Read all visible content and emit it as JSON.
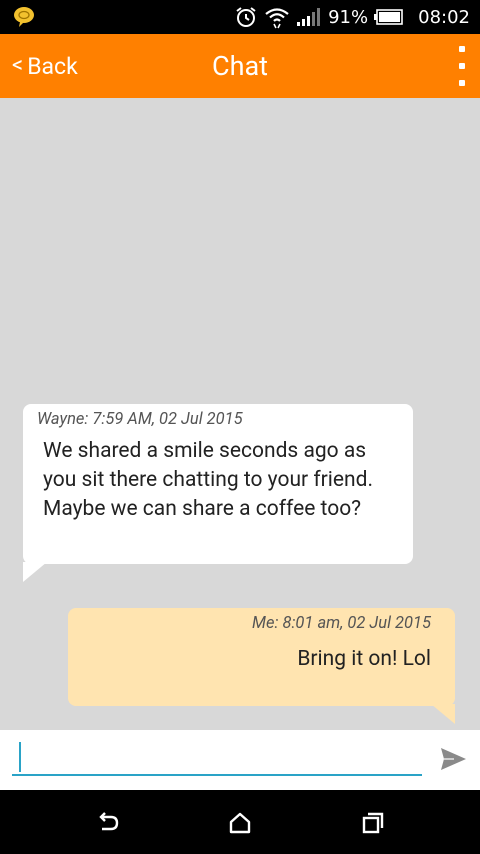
{
  "status_bar": {
    "battery_percent": "91%",
    "time": "08:02",
    "icons": [
      "chat-bubble-icon",
      "alarm-icon",
      "wifi-icon",
      "signal-icon",
      "battery-icon"
    ]
  },
  "app_bar": {
    "back_label": "Back",
    "back_chevron": "<",
    "title": "Chat",
    "menu_icon": "overflow-menu-icon",
    "color": "#ff8000"
  },
  "messages": [
    {
      "direction": "incoming",
      "meta": "Wayne: 7:59 AM, 02 Jul 2015",
      "text": "We shared a smile seconds ago as you sit there chatting to your friend. Maybe we can share a coffee too?",
      "bubble_color": "#ffffff"
    },
    {
      "direction": "outgoing",
      "meta": "Me: 8:01 am, 02 Jul 2015",
      "text": "Bring it on! Lol",
      "bubble_color": "#ffe4b0"
    }
  ],
  "composer": {
    "value": "",
    "placeholder": "",
    "send_icon": "send-icon",
    "accent_color": "#2aa3c7"
  },
  "nav_bar": {
    "icons": [
      "back-nav-icon",
      "home-icon",
      "recents-icon"
    ]
  }
}
